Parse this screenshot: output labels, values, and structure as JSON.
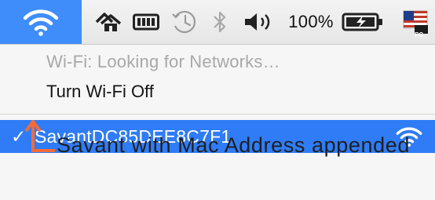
{
  "menubar": {
    "items": [
      {
        "icon": "wifi-icon",
        "active": true
      },
      {
        "icon": "home-sharing-icon"
      },
      {
        "icon": "battery-card-icon"
      },
      {
        "icon": "time-machine-icon"
      },
      {
        "icon": "bluetooth-icon"
      },
      {
        "icon": "volume-icon"
      },
      {
        "icon": "battery-charging-icon"
      },
      {
        "icon": "us-flag-input-icon"
      }
    ],
    "battery_percent": "100%",
    "input_source_label": "PC"
  },
  "wifi_menu": {
    "status": "Wi-Fi: Looking for Networks…",
    "toggle_label": "Turn Wi-Fi Off",
    "networks": [
      {
        "name": "SavantDC85DEE8C7F1",
        "connected": true,
        "checkmark": "✓"
      }
    ]
  },
  "annotation": {
    "text": "Savant with Mac Address appended",
    "color": "#f26b3a"
  },
  "colors": {
    "accent": "#2f7cf6",
    "menubar_bg": "#ececec",
    "menu_bg": "#f6f6f6",
    "annotation": "#f26b3a"
  }
}
